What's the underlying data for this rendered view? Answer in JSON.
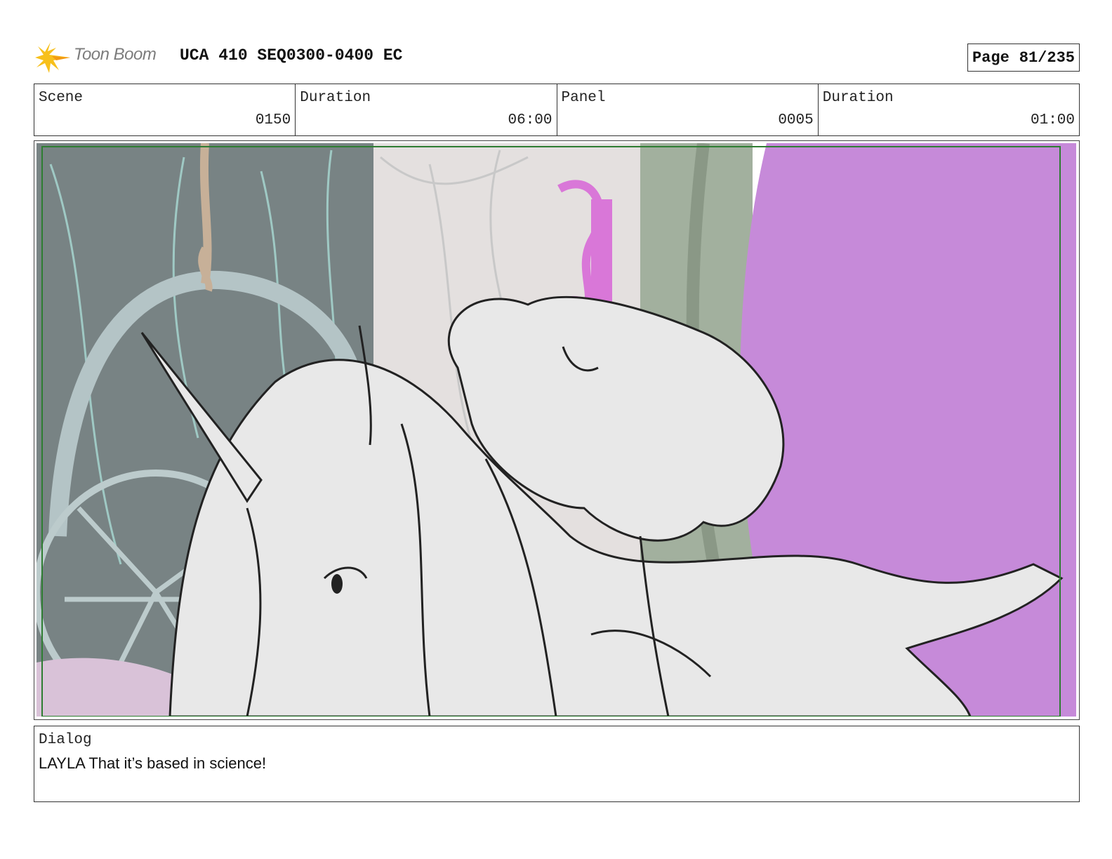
{
  "header": {
    "logo_text": "Toon Boom",
    "doc_title": "UCA 410 SEQ0300-0400 EC",
    "page_label": "Page",
    "page_number": "81/235"
  },
  "info": {
    "scene_label": "Scene",
    "scene_value": "0150",
    "scene_duration_label": "Duration",
    "scene_duration_value": "06:00",
    "panel_label": "Panel",
    "panel_value": "0005",
    "panel_duration_label": "Duration",
    "panel_duration_value": "01:00"
  },
  "dialog": {
    "label": "Dialog",
    "text": "LAYLA That it’s based in science!"
  },
  "colors": {
    "magenta_door": "#c68ad9",
    "wall_dark": "#788384",
    "wall_light": "#e4e0df",
    "frame_green": "#a2b09e",
    "lamp": "#d977d8",
    "safe_area": "#2e7d32",
    "logo_yellow": "#f7c01b"
  }
}
